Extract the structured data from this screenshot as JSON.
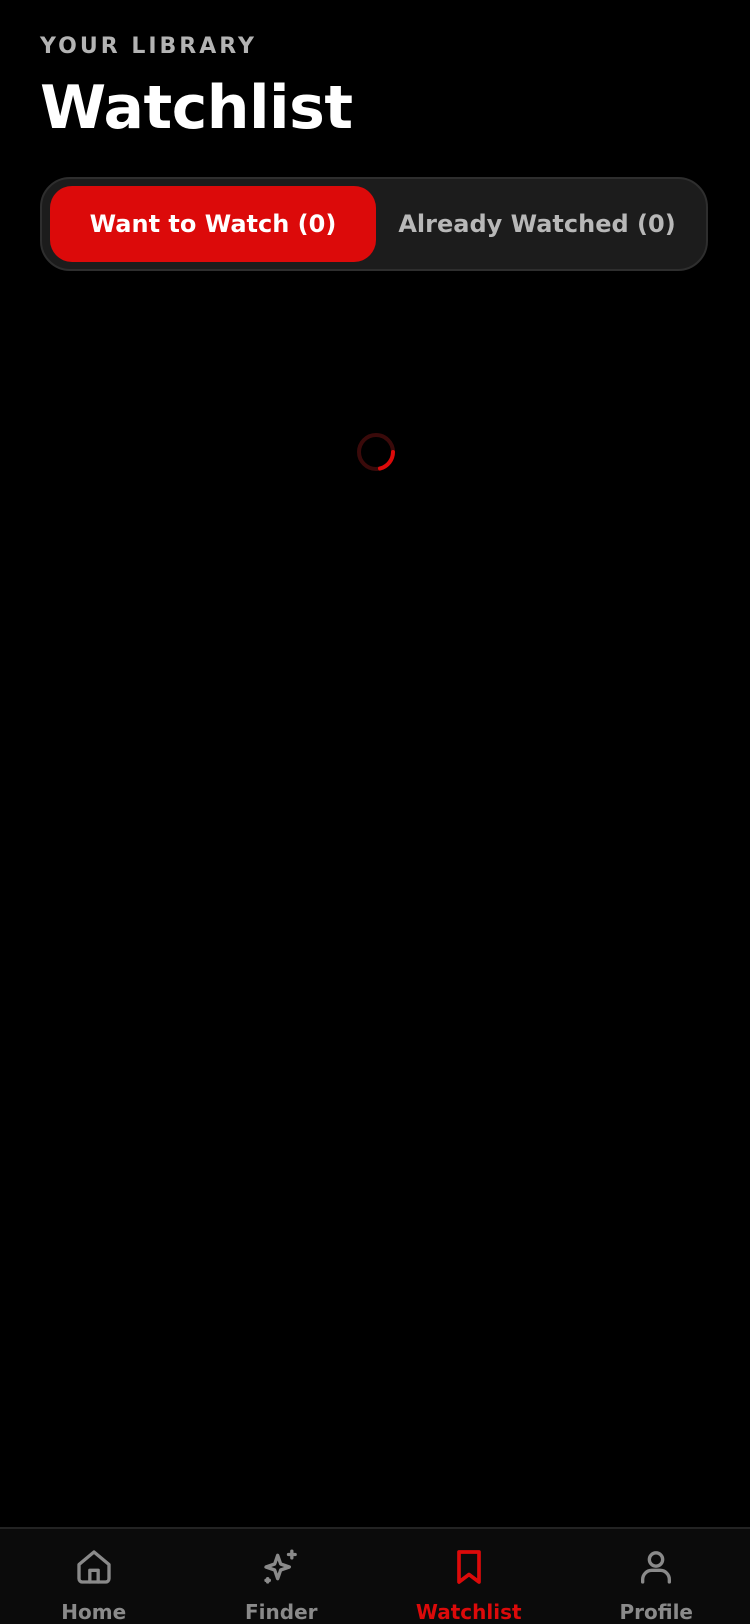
{
  "header": {
    "eyebrow": "YOUR LIBRARY",
    "title": "Watchlist"
  },
  "segments": [
    {
      "label": "Want to Watch (0)",
      "active": true
    },
    {
      "label": "Already Watched (0)",
      "active": false
    }
  ],
  "loading": {
    "icon": "spinner-icon"
  },
  "tabbar": {
    "items": [
      {
        "label": "Home",
        "icon": "home-icon",
        "active": false
      },
      {
        "label": "Finder",
        "icon": "sparkles-icon",
        "active": false
      },
      {
        "label": "Watchlist",
        "icon": "bookmark-icon",
        "active": true
      },
      {
        "label": "Profile",
        "icon": "user-icon",
        "active": false
      }
    ]
  },
  "colors": {
    "accent": "#dc0a0a",
    "background": "#000000",
    "muted": "#8a8a8a",
    "panel": "#1c1c1c"
  }
}
